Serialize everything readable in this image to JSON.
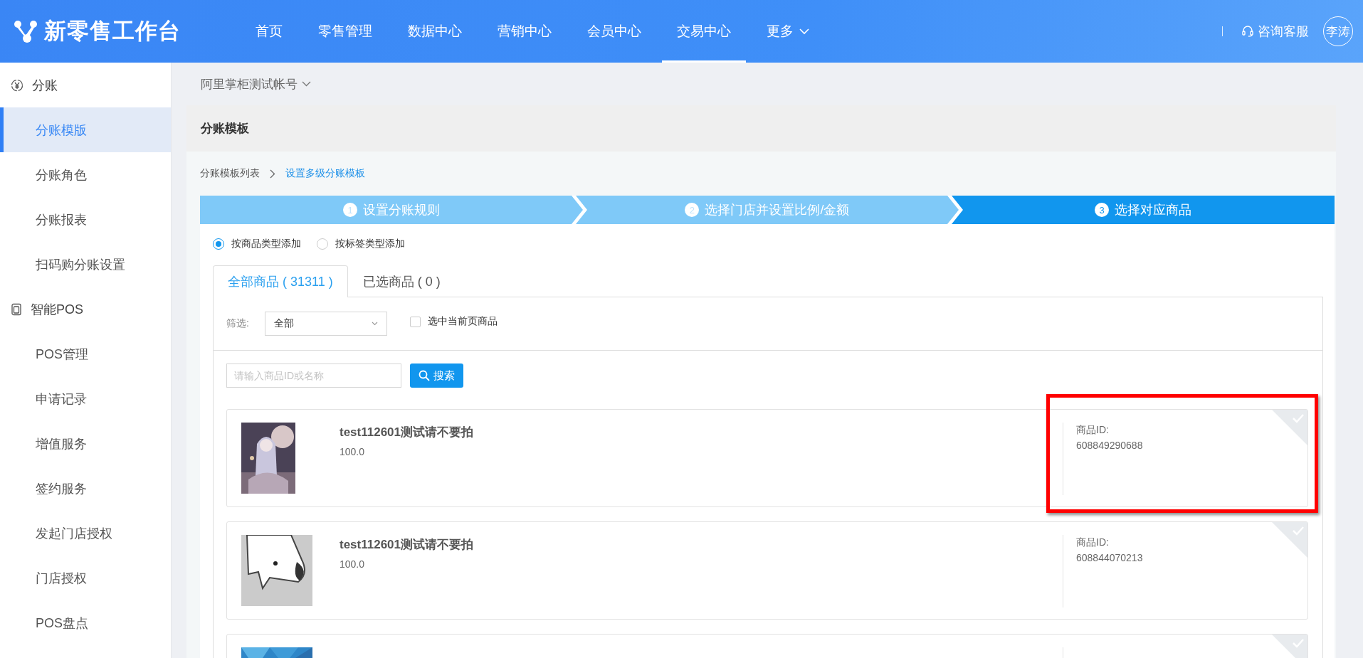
{
  "header": {
    "logo": "新零售工作台",
    "nav": [
      {
        "label": "首页",
        "selected": false,
        "dropdown": false
      },
      {
        "label": "零售管理",
        "selected": false,
        "dropdown": false
      },
      {
        "label": "数据中心",
        "selected": false,
        "dropdown": false
      },
      {
        "label": "营销中心",
        "selected": false,
        "dropdown": false
      },
      {
        "label": "会员中心",
        "selected": false,
        "dropdown": false
      },
      {
        "label": "交易中心",
        "selected": true,
        "dropdown": false
      },
      {
        "label": "更多",
        "selected": false,
        "dropdown": true
      }
    ],
    "support": "咨询客服",
    "avatar": "李涛"
  },
  "sidebar": {
    "groups": [
      {
        "label": "分账",
        "items": [
          {
            "label": "分账模版",
            "selected": true
          },
          {
            "label": "分账角色",
            "selected": false
          },
          {
            "label": "分账报表",
            "selected": false
          },
          {
            "label": "扫码购分账设置",
            "selected": false
          }
        ]
      },
      {
        "label": "智能POS",
        "items": [
          {
            "label": "POS管理",
            "selected": false
          },
          {
            "label": "申请记录",
            "selected": false
          },
          {
            "label": "增值服务",
            "selected": false
          },
          {
            "label": "签约服务",
            "selected": false
          },
          {
            "label": "发起门店授权",
            "selected": false
          },
          {
            "label": "门店授权",
            "selected": false
          },
          {
            "label": "POS盘点",
            "selected": false
          }
        ]
      }
    ]
  },
  "account": "阿里掌柜测试帐号",
  "panel": {
    "title": "分账模板",
    "breadcrumb": [
      {
        "label": "分账模板列表",
        "current": false
      },
      {
        "label": "设置多级分账模板",
        "current": true
      }
    ],
    "steps": [
      {
        "number": "1",
        "label": "设置分账规则",
        "active": false
      },
      {
        "number": "2",
        "label": "选择门店并设置比例/金额",
        "active": false
      },
      {
        "number": "3",
        "label": "选择对应商品",
        "active": true
      }
    ],
    "add_mode": [
      {
        "label": "按商品类型添加",
        "selected": true
      },
      {
        "label": "按标签类型添加",
        "selected": false
      }
    ],
    "tabs": [
      {
        "label": "全部商品 ( 31311 )",
        "selected": true
      },
      {
        "label": "已选商品 ( 0 )",
        "selected": false
      }
    ],
    "filter": {
      "label": "筛选:",
      "value": "全部",
      "select_page": {
        "label": "选中当前页商品",
        "checked": false
      }
    },
    "search": {
      "placeholder": "请输入商品ID或名称",
      "button": "搜索"
    },
    "products": [
      {
        "name": "test112601测试请不要拍",
        "price": "100.0",
        "id_label": "商品ID:",
        "id": "608849290688",
        "selected": false,
        "highlighted": true
      },
      {
        "name": "test112601测试请不要拍",
        "price": "100.0",
        "id_label": "商品ID:",
        "id": "608844070213",
        "selected": false,
        "highlighted": false
      },
      {
        "selected": false,
        "highlighted": false
      }
    ]
  }
}
